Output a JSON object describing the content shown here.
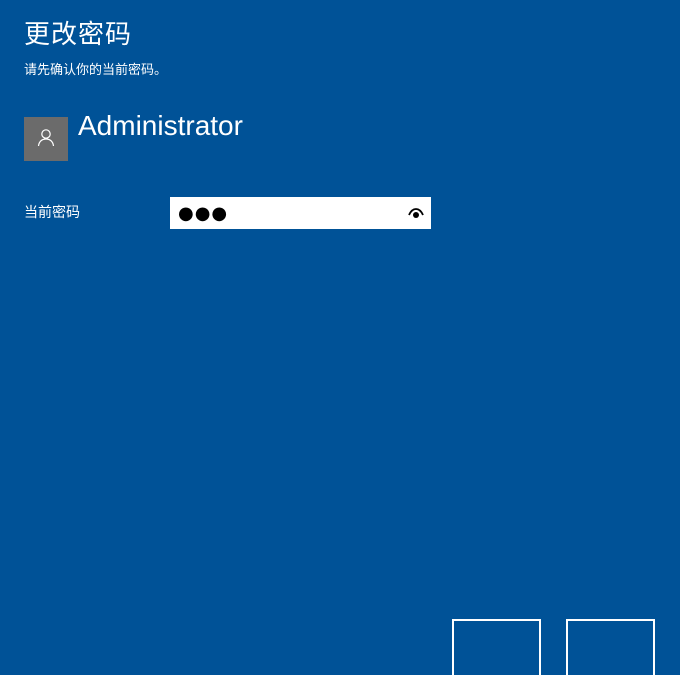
{
  "header": {
    "title": "更改密码",
    "subtitle": "请先确认你的当前密码。"
  },
  "account": {
    "avatar_icon": "user-icon",
    "username": "Administrator"
  },
  "form": {
    "current_password_label": "当前密码",
    "current_password_value": "●●●",
    "reveal_icon": "eye-icon"
  },
  "footer": {
    "next_label": "",
    "cancel_label": ""
  },
  "colors": {
    "background": "#005297",
    "avatar_bg": "#6b6b6b",
    "text": "#ffffff"
  }
}
